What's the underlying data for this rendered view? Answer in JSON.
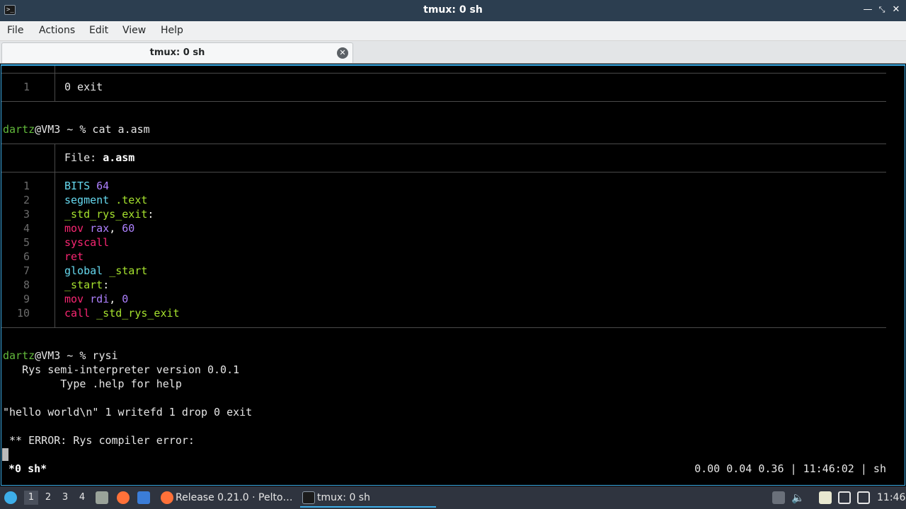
{
  "window": {
    "title": "tmux: 0 sh"
  },
  "menu": [
    "File",
    "Actions",
    "Edit",
    "View",
    "Help"
  ],
  "tab": {
    "label": "tmux: 0 sh"
  },
  "terminal": {
    "prev_block": {
      "line_no": "1",
      "code": "0 exit"
    },
    "prompt1": {
      "user": "dartz",
      "rest": "@VM3 ~ % cat a.asm"
    },
    "file_header": {
      "label": "File: ",
      "name": "a.asm"
    },
    "code_lines": [
      {
        "n": "1",
        "parts": [
          [
            "c-blue",
            "BITS "
          ],
          [
            "c-purple",
            "64"
          ]
        ]
      },
      {
        "n": "2",
        "parts": [
          [
            "c-blue",
            "segment "
          ],
          [
            "c-green",
            ".text"
          ]
        ]
      },
      {
        "n": "3",
        "parts": [
          [
            "c-green",
            "_std_rys_exit"
          ],
          [
            "c-white",
            ":"
          ]
        ]
      },
      {
        "n": "4",
        "parts": [
          [
            "c-red",
            "mov "
          ],
          [
            "c-purple",
            "rax"
          ],
          [
            "c-white",
            ", "
          ],
          [
            "c-purple",
            "60"
          ]
        ]
      },
      {
        "n": "5",
        "parts": [
          [
            "c-red",
            "syscall"
          ]
        ]
      },
      {
        "n": "6",
        "parts": [
          [
            "c-red",
            "ret"
          ]
        ]
      },
      {
        "n": "7",
        "parts": [
          [
            "c-blue",
            "global "
          ],
          [
            "c-green",
            "_start"
          ]
        ]
      },
      {
        "n": "8",
        "parts": [
          [
            "c-green",
            "_start"
          ],
          [
            "c-white",
            ":"
          ]
        ]
      },
      {
        "n": "9",
        "parts": [
          [
            "c-red",
            "mov "
          ],
          [
            "c-purple",
            "rdi"
          ],
          [
            "c-white",
            ", "
          ],
          [
            "c-purple",
            "0"
          ]
        ]
      },
      {
        "n": "10",
        "parts": [
          [
            "c-red",
            "call "
          ],
          [
            "c-green",
            "_std_rys_exit"
          ]
        ]
      }
    ],
    "prompt2": {
      "user": "dartz",
      "rest": "@VM3 ~ % rysi"
    },
    "rysi_banner1": "   Rys semi-interpreter version 0.0.1",
    "rysi_banner2": "         Type .help for help",
    "input_line": "\"hello world\\n\" 1 writefd 1 drop 0 exit",
    "error_line": " ** ERROR: Rys compiler error:"
  },
  "tmux_status": {
    "left": "*0 sh*",
    "right": "0.00 0.04 0.36 | 11:46:02 | sh"
  },
  "taskbar": {
    "workspaces": [
      "1",
      "2",
      "3",
      "4"
    ],
    "tasks": [
      {
        "label": "Release 0.21.0 · Pelto…",
        "icon": "firefox-icon"
      },
      {
        "label": "tmux: 0 sh",
        "icon": "terminal-icon"
      }
    ],
    "clock": "11:46"
  }
}
